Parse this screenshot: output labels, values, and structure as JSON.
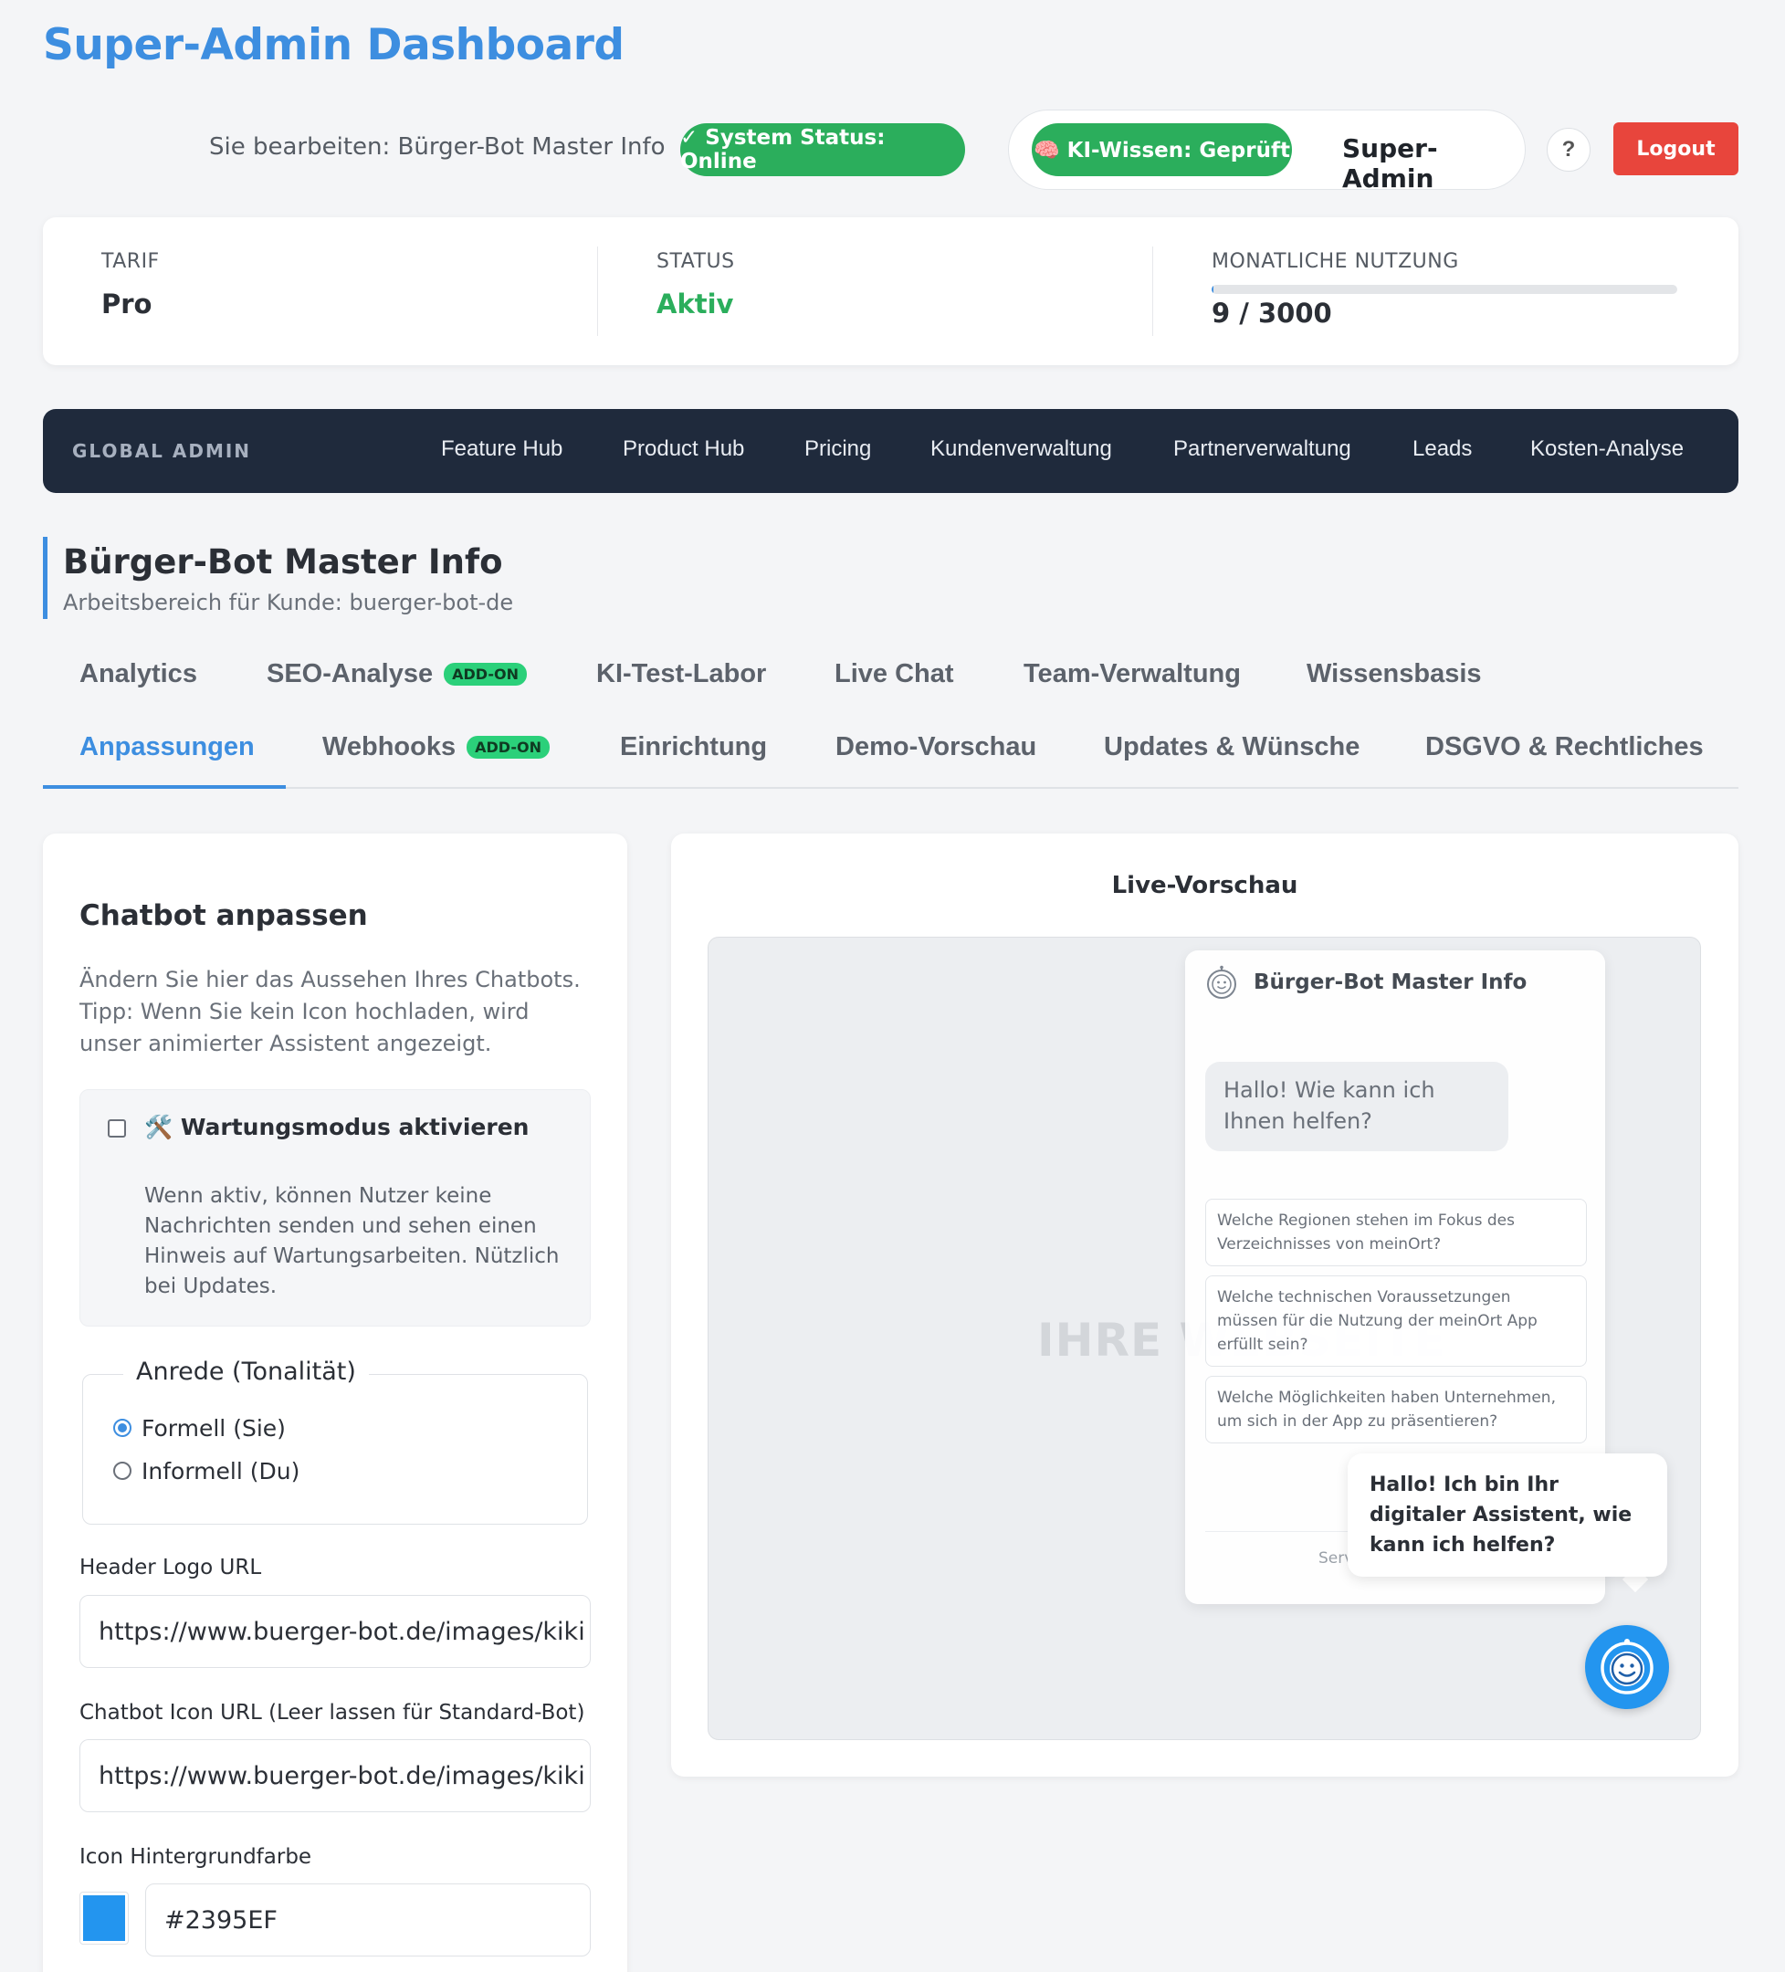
{
  "app_title": "Super-Admin Dashboard",
  "topbar": {
    "editing_text": "Sie bearbeiten: Bürger-Bot Master Info",
    "system_status": "✓ System Status: Online",
    "ki_status": "🧠 KI-Wissen: Geprüft",
    "user_role": "Super-Admin",
    "help_label": "?",
    "logout_label": "Logout"
  },
  "info": {
    "tariff_label": "TARIF",
    "tariff_value": "Pro",
    "status_label": "STATUS",
    "status_value": "Aktiv",
    "usage_label": "MONATLICHE NUTZUNG",
    "usage_value": "9 / 3000",
    "usage_used": 9,
    "usage_limit": 3000
  },
  "admin_nav": {
    "label": "GLOBAL ADMIN",
    "links": [
      "Feature Hub",
      "Product Hub",
      "Pricing",
      "Kundenverwaltung",
      "Partnerverwaltung",
      "Leads",
      "Kosten-Analyse"
    ]
  },
  "workspace": {
    "title": "Bürger-Bot Master Info",
    "subtitle": "Arbeitsbereich für Kunde: buerger-bot-de"
  },
  "tabs": {
    "row1": [
      {
        "label": "Analytics"
      },
      {
        "label": "SEO-Analyse",
        "badge": "ADD-ON"
      },
      {
        "label": "KI-Test-Labor"
      },
      {
        "label": "Live Chat"
      },
      {
        "label": "Team-Verwaltung"
      },
      {
        "label": "Wissensbasis"
      }
    ],
    "row2": [
      {
        "label": "Anpassungen",
        "active": true
      },
      {
        "label": "Webhooks",
        "badge": "ADD-ON"
      },
      {
        "label": "Einrichtung"
      },
      {
        "label": "Demo-Vorschau"
      },
      {
        "label": "Updates & Wünsche"
      },
      {
        "label": "DSGVO & Rechtliches"
      }
    ]
  },
  "customize": {
    "title": "Chatbot anpassen",
    "description": "Ändern Sie hier das Aussehen Ihres Chatbots. Tipp: Wenn Sie kein Icon hochladen, wird unser animierter Assistent angezeigt.",
    "maintenance_label": "🛠️ Wartungsmodus aktivieren",
    "maintenance_checked": false,
    "maintenance_help": "Wenn aktiv, können Nutzer keine Nachrichten senden und sehen einen Hinweis auf Wartungsarbeiten. Nützlich bei Updates.",
    "tone_legend": "Anrede (Tonalität)",
    "tone_formal": "Formell (Sie)",
    "tone_informal": "Informell (Du)",
    "tone_selected": "formal",
    "header_logo_label": "Header Logo URL",
    "header_logo_value": "https://www.buerger-bot.de/images/kiki",
    "icon_url_label": "Chatbot Icon URL (Leer lassen für Standard-Bot)",
    "icon_url_value": "https://www.buerger-bot.de/images/kiki",
    "icon_bg_label": "Icon Hintergrundfarbe",
    "icon_bg_value": "#2395EF"
  },
  "preview": {
    "title": "Live-Vorschau",
    "watermark": "IHRE WEBSEITE",
    "chat_title": "Bürger-Bot Master Info",
    "welcome": "Hallo! Wie kann ich Ihnen helfen?",
    "suggestions": [
      "Welche Regionen stehen im Fokus des Verzeichnisses von meinOrt?",
      "Welche technischen Voraussetzungen müssen für die Nutzung der meinOrt App erfüllt sein?",
      "Welche Möglichkeiten haben Unternehmen, um sich in der App zu präsentieren?"
    ],
    "footer_fragment": "Serv",
    "greeting": "Hallo! Ich bin Ihr digitaler Assistent, wie kann ich helfen?"
  },
  "colors": {
    "accent": "#3d8ee0",
    "success": "#2bae5c",
    "danger": "#e8453c",
    "nav_bg": "#1f2a3c",
    "icon_bg": "#2395EF"
  }
}
